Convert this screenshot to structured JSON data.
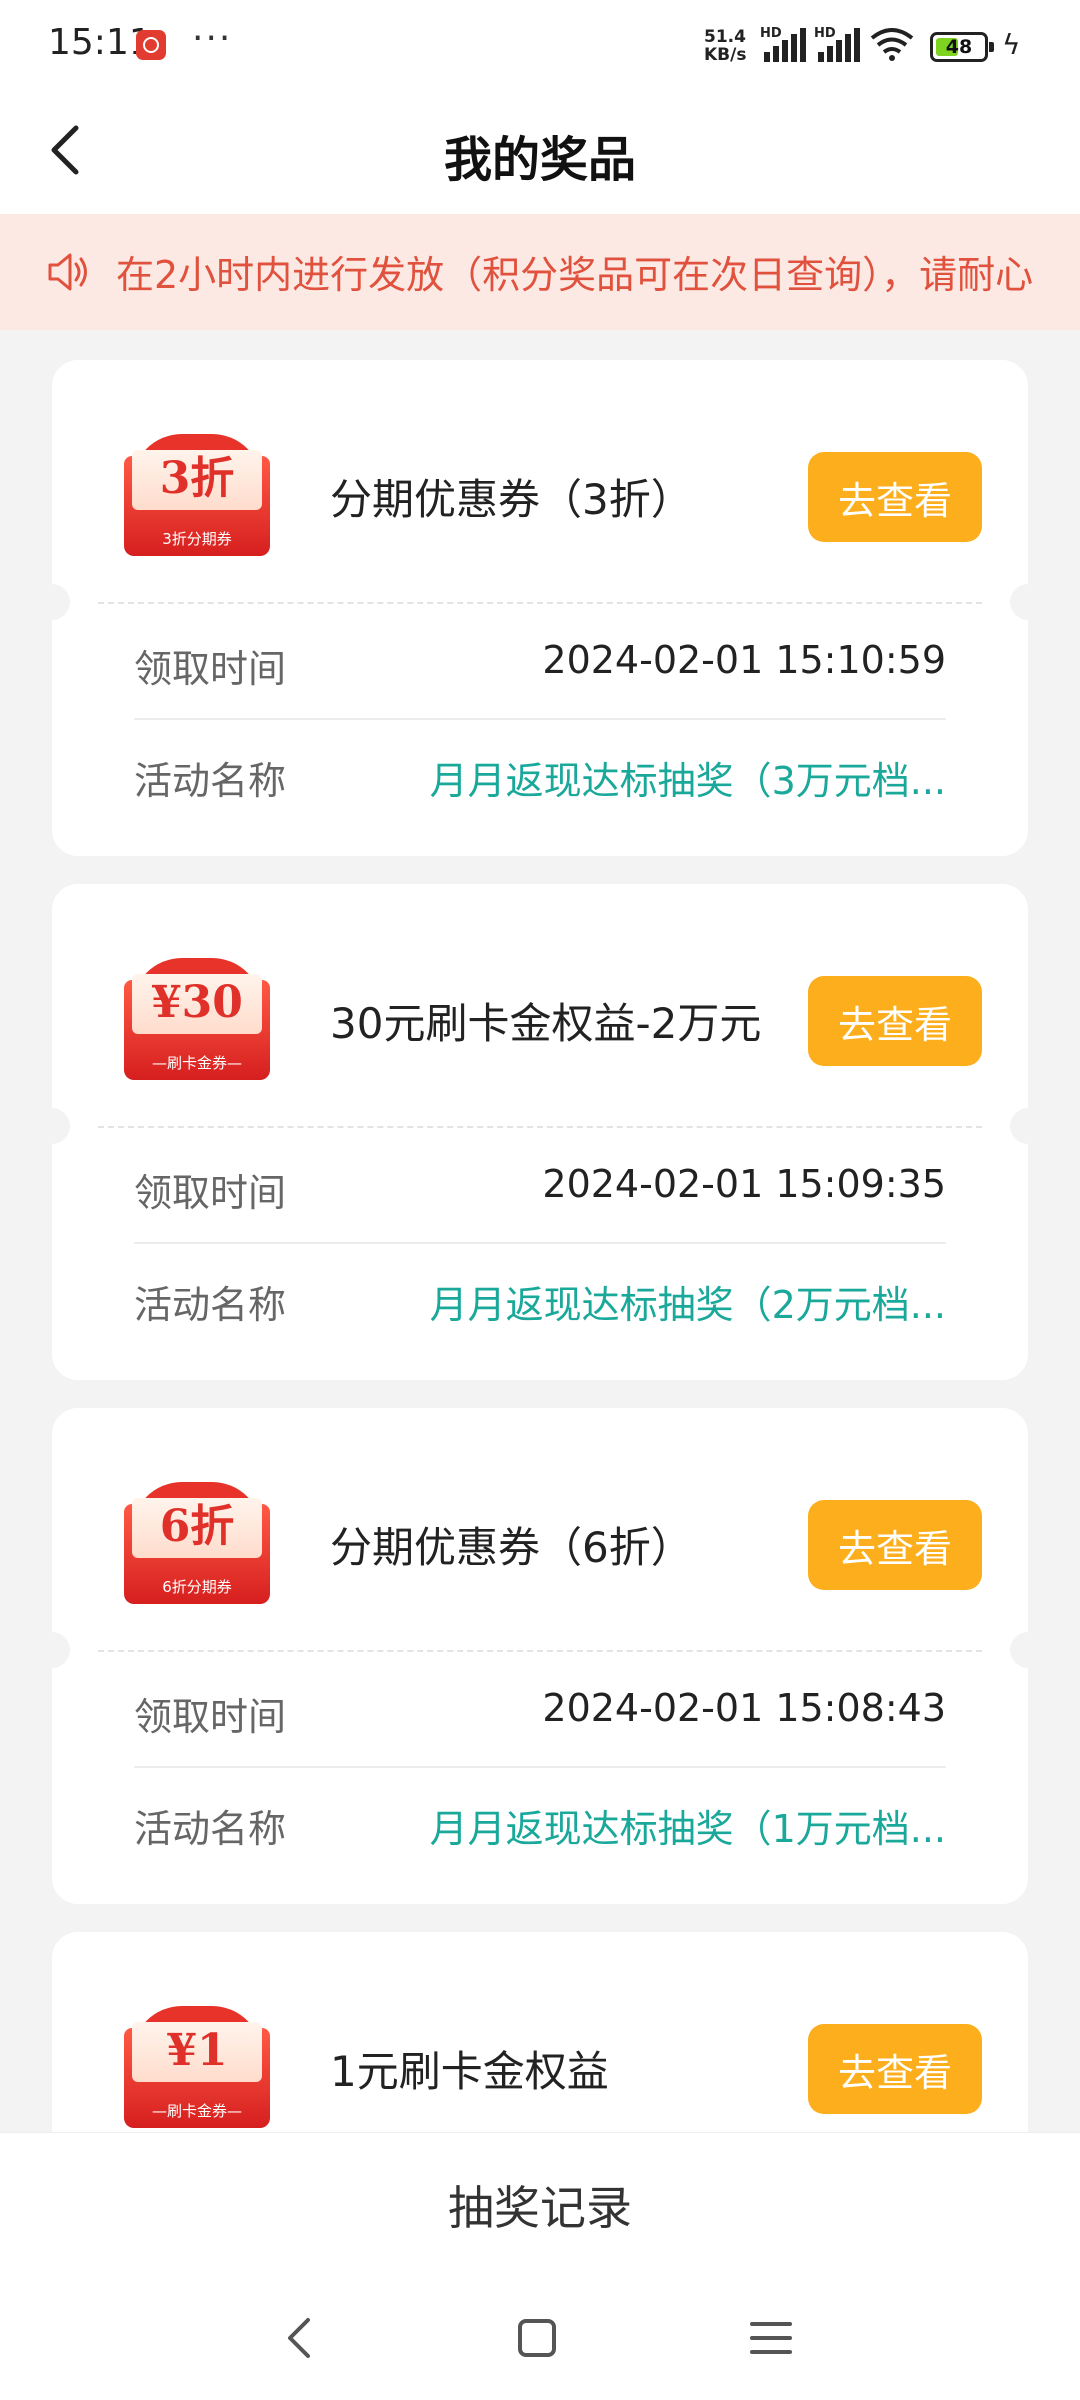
{
  "status_bar": {
    "time": "15:11",
    "dots": "···",
    "net_speed": "51.4\nKB/s",
    "hd1": "HD",
    "hd2": "HD",
    "battery": "48",
    "battery_level_percent": 48
  },
  "header": {
    "title": "我的奖品"
  },
  "notice": {
    "text": "在2小时内进行发放（积分奖品可在次日查询），请耐心"
  },
  "prizes": [
    {
      "coupon_big": "3折",
      "coupon_sub": "3折分期券",
      "name": "分期优惠券（3折）",
      "button": "去查看",
      "time_label": "领取时间",
      "time_value": "2024-02-01 15:10:59",
      "activity_label": "活动名称",
      "activity_value": "月月返现达标抽奖（3万元档..."
    },
    {
      "coupon_big": "¥30",
      "coupon_sub": "—刷卡金券—",
      "name": "30元刷卡金权益-2万元",
      "button": "去查看",
      "time_label": "领取时间",
      "time_value": "2024-02-01 15:09:35",
      "activity_label": "活动名称",
      "activity_value": "月月返现达标抽奖（2万元档..."
    },
    {
      "coupon_big": "6折",
      "coupon_sub": "6折分期券",
      "name": "分期优惠券（6折）",
      "button": "去查看",
      "time_label": "领取时间",
      "time_value": "2024-02-01 15:08:43",
      "activity_label": "活动名称",
      "activity_value": "月月返现达标抽奖（1万元档..."
    },
    {
      "coupon_big": "¥1",
      "coupon_sub": "—刷卡金券—",
      "name": "1元刷卡金权益",
      "button": "去查看"
    }
  ],
  "bottom": {
    "draw_records": "抽奖记录"
  },
  "colors": {
    "accent_button": "#fcae1d",
    "link_green": "#1aa89a",
    "notice_text": "#e0523e",
    "notice_bg": "#fde9e3"
  },
  "icons": [
    "back-arrow-icon",
    "speaker-icon",
    "nav-back-icon",
    "nav-home-icon",
    "nav-menu-icon"
  ]
}
